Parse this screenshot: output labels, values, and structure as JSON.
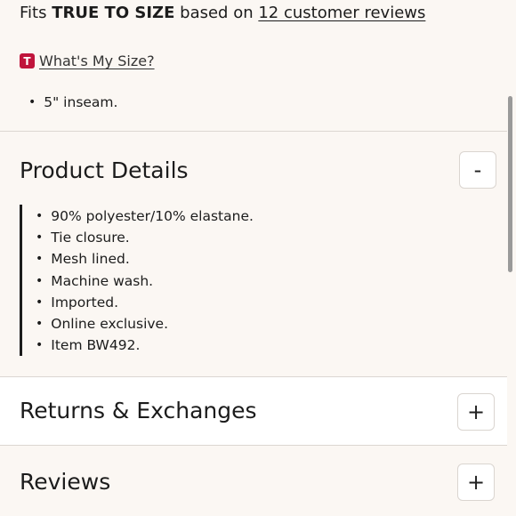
{
  "fit": {
    "prefix": "Fits",
    "emphasis": "TRUE TO SIZE",
    "middle": "based on",
    "reviews_link": "12 customer reviews"
  },
  "size_guide": {
    "badge": "T",
    "link": "What's My Size?"
  },
  "fit_bullets": [
    "5\" inseam."
  ],
  "product_details": {
    "title": "Product Details",
    "toggle": "-",
    "items": [
      "90% polyester/10% elastane.",
      "Tie closure.",
      "Mesh lined.",
      "Machine wash.",
      "Imported.",
      "Online exclusive.",
      "Item BW492."
    ]
  },
  "returns": {
    "title": "Returns & Exchanges",
    "toggle": "+"
  },
  "reviews": {
    "title": "Reviews",
    "toggle": "+"
  },
  "colors": {
    "badge": "#c0143c",
    "background": "#fbf7f3",
    "band": "#ffffff"
  }
}
